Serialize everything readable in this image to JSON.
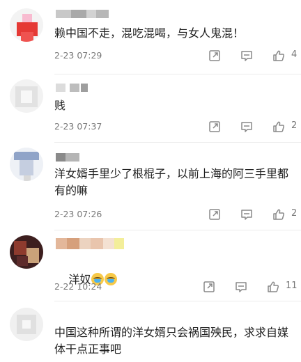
{
  "comments": [
    {
      "text": "赖中国不走，混吃混喝，与女人鬼混！",
      "time": "2-23 07:29",
      "likes": "4",
      "avatar_colors": [
        "#e53935",
        "#ef5350",
        "#f8bbd0"
      ]
    },
    {
      "text": "贱",
      "time": "2-23 07:37",
      "likes": "2",
      "avatar_colors": [
        "#e0e0e0",
        "#d5d5d5",
        "#eeeeee"
      ]
    },
    {
      "text": "洋女婿手里少了根棍子，以前上海的阿三手里都有的嘛",
      "time": "2-23 07:26",
      "likes": "2",
      "avatar_colors": [
        "#90a4c8",
        "#c5cee0",
        "#e3e7ef"
      ]
    },
    {
      "text": "洋奴",
      "time": "2-22 10:24",
      "likes": "11",
      "avatar_colors": [
        "#5d2b2b",
        "#8e3b2e",
        "#c9a27a"
      ]
    },
    {
      "text": "中国这种所谓的洋女婿只会祸国殃民，求求自媒体干点正事吧",
      "time": "",
      "likes": "",
      "avatar_colors": [
        "#d8d8d8",
        "#e6e6e6",
        "#cfcfcf"
      ]
    }
  ],
  "icons": {
    "share": "share-icon",
    "comment": "comment-icon",
    "like": "like-icon"
  }
}
